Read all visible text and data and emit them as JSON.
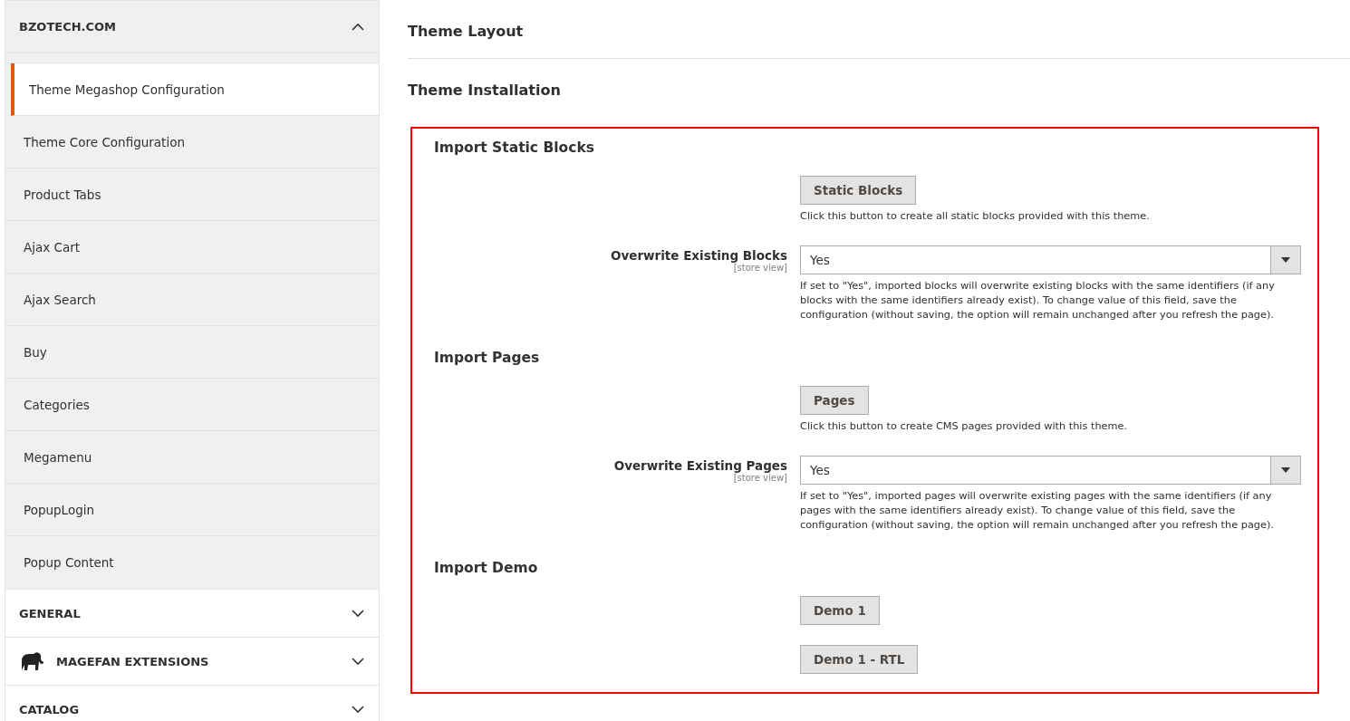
{
  "sidebar": {
    "sections": [
      {
        "title": "BZOTECH.COM",
        "expanded": true,
        "kind": "plain",
        "items": [
          {
            "label": "Theme Megashop Configuration",
            "selected": true
          },
          {
            "label": "Theme Core Configuration",
            "selected": false
          },
          {
            "label": "Product Tabs",
            "selected": false
          },
          {
            "label": "Ajax Cart",
            "selected": false
          },
          {
            "label": "Ajax Search",
            "selected": false
          },
          {
            "label": "Buy",
            "selected": false
          },
          {
            "label": "Categories",
            "selected": false
          },
          {
            "label": "Megamenu",
            "selected": false
          },
          {
            "label": "PopupLogin",
            "selected": false
          },
          {
            "label": "Popup Content",
            "selected": false
          }
        ]
      },
      {
        "title": "GENERAL",
        "expanded": false,
        "kind": "plain"
      },
      {
        "title": "MAGEFAN EXTENSIONS",
        "expanded": false,
        "kind": "logo"
      },
      {
        "title": "CATALOG",
        "expanded": false,
        "kind": "plain"
      }
    ]
  },
  "main": {
    "collapsed_sections": [
      "Theme Layout",
      "Theme Installation"
    ],
    "groups": [
      {
        "title": "Import Static Blocks",
        "buttons": [
          "Static Blocks"
        ],
        "button_note": "Click this button to create all static blocks provided with this theme.",
        "field": {
          "label": "Overwrite Existing Blocks",
          "scope": "[store view]",
          "value": "Yes",
          "note": "If set to \"Yes\", imported blocks will overwrite existing blocks with the same identifiers (if any blocks with the same identifiers already exist). To change value of this field, save the configuration (without saving, the option will remain unchanged after you refresh the page)."
        }
      },
      {
        "title": "Import Pages",
        "buttons": [
          "Pages"
        ],
        "button_note": "Click this button to create CMS pages provided with this theme.",
        "field": {
          "label": "Overwrite Existing Pages",
          "scope": "[store view]",
          "value": "Yes",
          "note": "If set to \"Yes\", imported pages will overwrite existing pages with the same identifiers (if any pages with the same identifiers already exist). To change value of this field, save the configuration (without saving, the option will remain unchanged after you refresh the page)."
        }
      },
      {
        "title": "Import Demo",
        "buttons": [
          "Demo 1",
          "Demo 1 - RTL"
        ]
      }
    ]
  }
}
